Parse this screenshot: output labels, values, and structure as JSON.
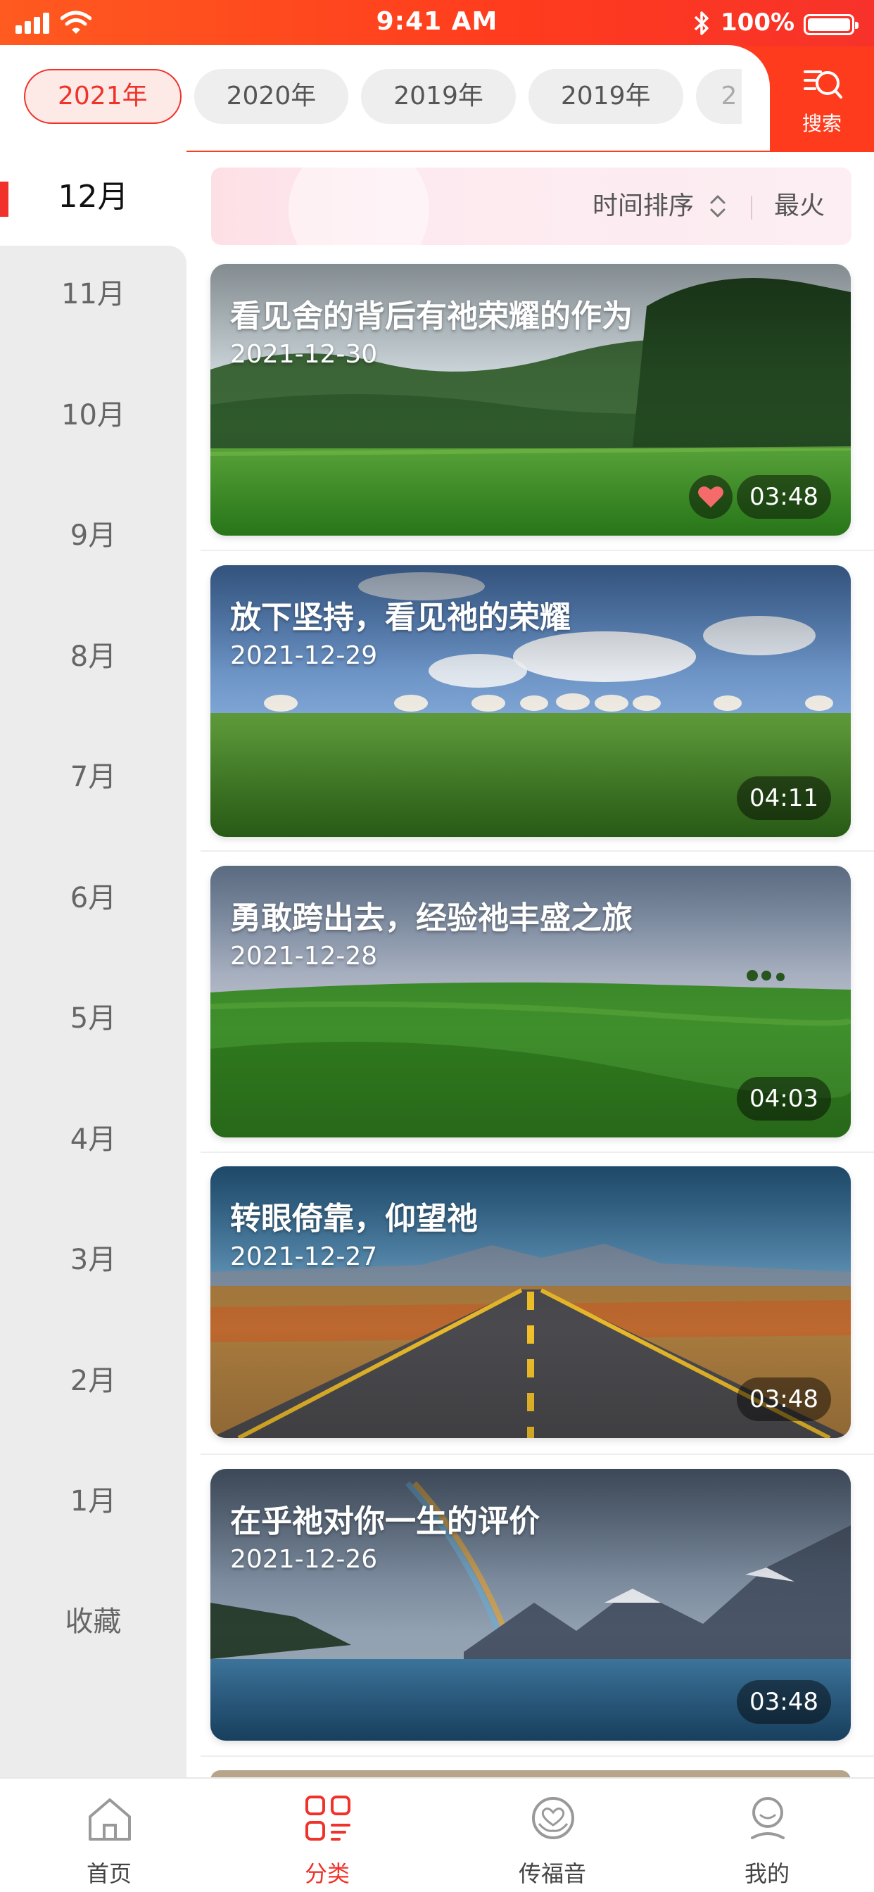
{
  "status_bar": {
    "time": "9:41 AM",
    "battery": "100%"
  },
  "header": {
    "years": [
      "2021年",
      "2020年",
      "2019年",
      "2019年"
    ],
    "years_partial": "2",
    "active_year": "2021年",
    "search_label": "搜索"
  },
  "sidebar": {
    "months": [
      "12月",
      "11月",
      "10月",
      "9月",
      "8月",
      "7月",
      "6月",
      "5月",
      "4月",
      "3月",
      "2月",
      "1月",
      "收藏"
    ],
    "active": "12月"
  },
  "sort_bar": {
    "time_sort": "时间排序",
    "hot": "最火"
  },
  "videos": [
    {
      "title": "看见舍的背后有祂荣耀的作为",
      "date": "2021-12-30",
      "duration": "03:48",
      "favorited": true
    },
    {
      "title": "放下坚持，看见祂的荣耀",
      "date": "2021-12-29",
      "duration": "04:11",
      "favorited": false
    },
    {
      "title": "勇敢跨出去，经验祂丰盛之旅",
      "date": "2021-12-28",
      "duration": "04:03",
      "favorited": false
    },
    {
      "title": "转眼倚靠，仰望祂",
      "date": "2021-12-27",
      "duration": "03:48",
      "favorited": false
    },
    {
      "title": "在乎祂对你一生的评价",
      "date": "2021-12-26",
      "duration": "03:48",
      "favorited": false
    }
  ],
  "tab_bar": {
    "items": [
      "首页",
      "分类",
      "传福音",
      "我的"
    ],
    "active": "分类"
  },
  "colors": {
    "accent": "#f0322a",
    "header_gradient_start": "#ff5a1f",
    "sidebar_bg": "#ececec"
  }
}
